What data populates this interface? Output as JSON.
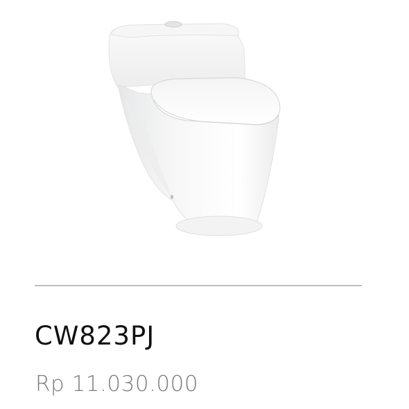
{
  "product": {
    "image_icon": "one-piece-toilet-image",
    "name": "CW823PJ",
    "price": "Rp 11.030.000"
  },
  "colors": {
    "divider": "#bdbdbd",
    "name_text": "#111111",
    "price_text": "#7a7a7a"
  }
}
